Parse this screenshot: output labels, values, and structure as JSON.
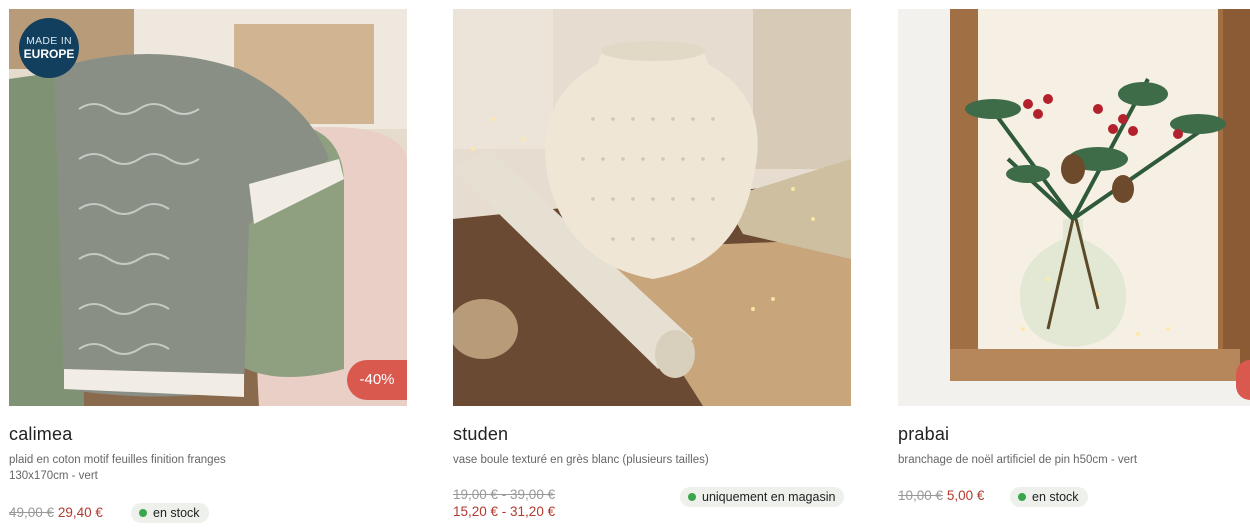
{
  "colors": {
    "discount": "#d9594f",
    "sale_price": "#b23a2e",
    "in_stock": "#3aa64c",
    "badge": "#123f5e"
  },
  "products": [
    {
      "name": "calimea",
      "badge_line1": "MADE IN",
      "badge_line2": "EUROPE",
      "discount": "-40%",
      "desc_line1": "plaid en coton motif feuilles finition franges",
      "desc_line2": "130x170cm - vert",
      "old_price": "49,00 €",
      "new_price": "29,40 €",
      "stock": "en stock"
    },
    {
      "name": "studen",
      "desc_line1": "vase boule texturé en grès blanc (plusieurs tailles)",
      "old_price": "19,00 € - 39,00 €",
      "new_price": "15,20 € - 31,20 €",
      "stock": "uniquement en magasin"
    },
    {
      "name": "prabai",
      "desc_line1": "branchage de noël artificiel de pin h50cm - vert",
      "old_price": "10,00 €",
      "new_price": "5,00 €",
      "stock": "en stock"
    }
  ]
}
